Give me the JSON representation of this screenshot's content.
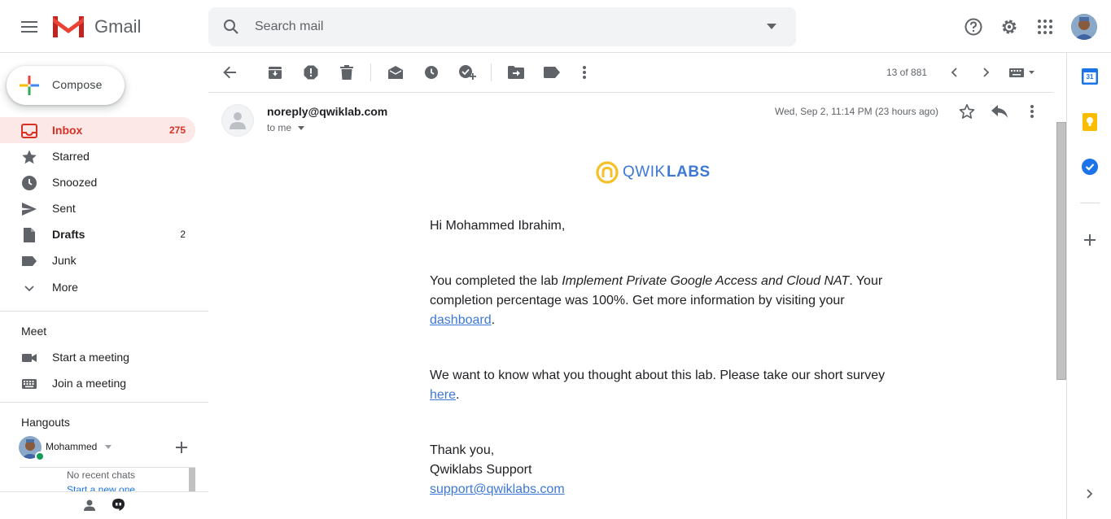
{
  "app": {
    "brand": "Gmail"
  },
  "search": {
    "placeholder": "Search mail"
  },
  "compose": {
    "label": "Compose"
  },
  "sidebar": {
    "items": [
      {
        "label": "Inbox",
        "count": "275"
      },
      {
        "label": "Starred",
        "count": ""
      },
      {
        "label": "Snoozed",
        "count": ""
      },
      {
        "label": "Sent",
        "count": ""
      },
      {
        "label": "Drafts",
        "count": "2"
      },
      {
        "label": "Junk",
        "count": ""
      },
      {
        "label": "More",
        "count": ""
      }
    ]
  },
  "meet": {
    "title": "Meet",
    "items": [
      {
        "label": "Start a meeting"
      },
      {
        "label": "Join a meeting"
      }
    ]
  },
  "hangouts": {
    "title": "Hangouts",
    "user": "Mohammed",
    "no_chats": "No recent chats",
    "start_new": "Start a new one"
  },
  "toolbar": {
    "pagination": "13 of 881"
  },
  "message": {
    "sender": "noreply@qwiklab.com",
    "to": "to me",
    "date": "Wed, Sep 2, 11:14 PM (23 hours ago)",
    "logo_text_a": "QWIK",
    "logo_text_b": "LABS",
    "greeting": "Hi Mohammed Ibrahim,",
    "p1_a": "You completed the lab ",
    "p1_lab": "Implement Private Google Access and Cloud NAT",
    "p1_b": ". Your completion percentage was 100%. Get more information by visiting your ",
    "p1_link": "dashboard",
    "p1_c": ".",
    "p2_a": "We want to know what you thought about this lab. Please take our short survey ",
    "p2_link": "here",
    "p2_b": ".",
    "sign1": "Thank you,",
    "sign2": "Qwiklabs Support",
    "sign_email": "support@qwiklabs.com"
  },
  "right_rail": {
    "calendar_day": "31"
  },
  "colors": {
    "accent_red": "#d93025",
    "active_bg": "#fce8e6",
    "link": "#3c78d8",
    "qwiklabs_blue": "#3c78d8",
    "qwiklabs_yellow": "#f6c026"
  }
}
